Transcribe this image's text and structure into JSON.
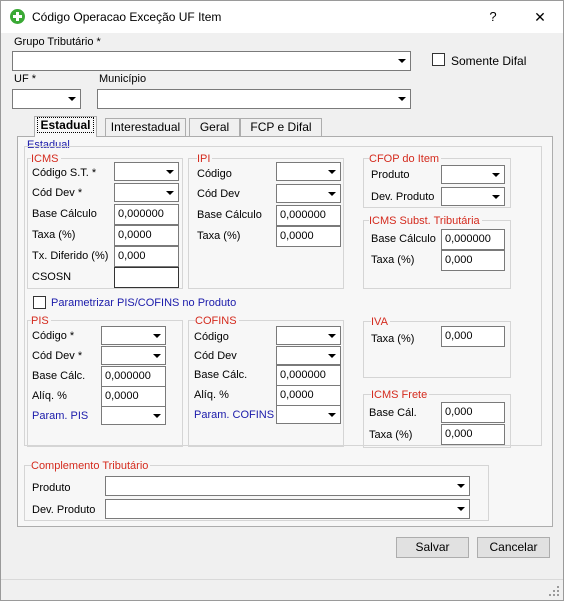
{
  "window": {
    "title": "Código Operacao Exceção UF Item",
    "help_label": "?",
    "close_label": "✕"
  },
  "header": {
    "grupo_tributario_label": "Grupo Tributário *",
    "grupo_tributario_value": "",
    "somente_difal_label": "Somente Difal",
    "uf_label": "UF *",
    "uf_value": "",
    "municipio_label": "Município",
    "municipio_value": ""
  },
  "tabs": [
    "Estadual",
    "Interestadual",
    "Geral",
    "FCP e Difal"
  ],
  "estadual": {
    "section_label": "Estadual",
    "icms": {
      "title": "ICMS",
      "codigo_st_label": "Código S.T. *",
      "cod_dev_label": "Cód Dev *",
      "base_calculo_label": "Base Cálculo",
      "base_calculo_value": "0,000000",
      "taxa_label": "Taxa (%)",
      "taxa_value": "0,0000",
      "tx_diferido_label": "Tx. Diferido (%)",
      "tx_diferido_value": "0,000",
      "csosn_label": "CSOSN",
      "csosn_value": ""
    },
    "ipi": {
      "title": "IPI",
      "codigo_label": "Código",
      "cod_dev_label": "Cód Dev",
      "base_calculo_label": "Base Cálculo",
      "base_calculo_value": "0,000000",
      "taxa_label": "Taxa (%)",
      "taxa_value": "0,0000"
    },
    "cfop": {
      "title": "CFOP do Item",
      "produto_label": "Produto",
      "dev_produto_label": "Dev. Produto"
    },
    "icms_st": {
      "title": "ICMS Subst. Tributária",
      "base_calculo_label": "Base Cálculo",
      "base_calculo_value": "0,000000",
      "taxa_label": "Taxa (%)",
      "taxa_value": "0,000"
    },
    "parametrizar_label": "Parametrizar PIS/COFINS no Produto",
    "pis": {
      "title": "PIS",
      "codigo_label": "Código *",
      "cod_dev_label": "Cód Dev *",
      "base_calc_label": "Base Cálc.",
      "base_calc_value": "0,000000",
      "aliq_label": "Alíq. %",
      "aliq_value": "0,0000",
      "param_label": "Param. PIS"
    },
    "cofins": {
      "title": "COFINS",
      "codigo_label": "Código",
      "cod_dev_label": "Cód Dev",
      "base_calc_label": "Base Cálc.",
      "base_calc_value": "0,000000",
      "aliq_label": "Alíq. %",
      "aliq_value": "0,0000",
      "param_label": "Param. COFINS"
    },
    "iva": {
      "title": "IVA",
      "taxa_label": "Taxa (%)",
      "taxa_value": "0,000"
    },
    "icms_frete": {
      "title": "ICMS Frete",
      "base_cal_label": "Base Cál.",
      "base_cal_value": "0,000",
      "taxa_label": "Taxa (%)",
      "taxa_value": "0,000"
    },
    "complemento": {
      "title": "Complemento Tributário",
      "produto_label": "Produto",
      "dev_produto_label": "Dev. Produto"
    }
  },
  "footer": {
    "salvar_label": "Salvar",
    "cancelar_label": "Cancelar"
  }
}
